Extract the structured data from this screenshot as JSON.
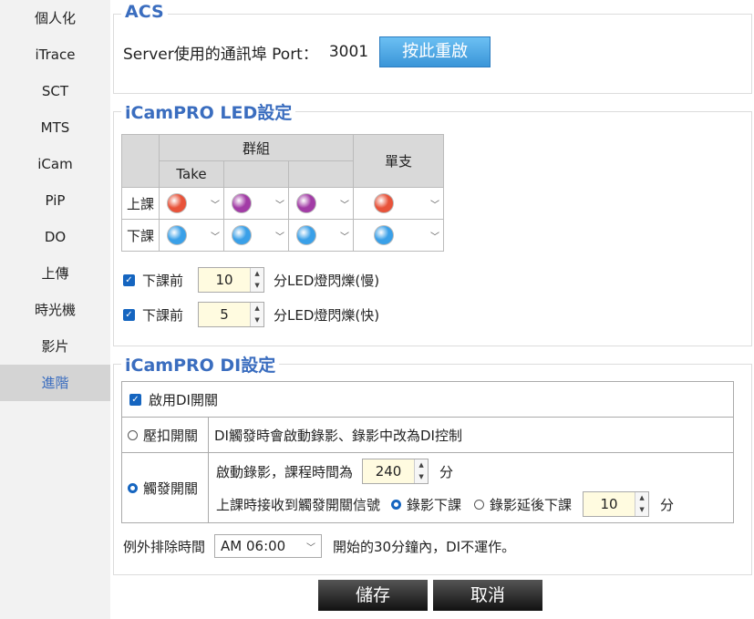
{
  "sidebar": {
    "items": [
      {
        "label": "個人化"
      },
      {
        "label": "iTrace"
      },
      {
        "label": "SCT"
      },
      {
        "label": "MTS"
      },
      {
        "label": "iCam"
      },
      {
        "label": "PiP"
      },
      {
        "label": "DO"
      },
      {
        "label": "上傳"
      },
      {
        "label": "時光機"
      },
      {
        "label": "影片"
      },
      {
        "label": "進階"
      }
    ],
    "active_index": 10
  },
  "acs": {
    "title": "ACS",
    "port_label": "Server使用的通訊埠 Port：",
    "port_value": "3001",
    "restart_button": "按此重啟"
  },
  "led": {
    "title": "iCamPRO LED設定",
    "group_header": "群組",
    "take_header": "Take",
    "single_header": "單支",
    "rows": [
      {
        "label": "上課",
        "colors": [
          "#e8533a",
          "#a23ca6",
          "#a23ca6",
          "#e8533a"
        ]
      },
      {
        "label": "下課",
        "colors": [
          "#3aa0e8",
          "#3aa0e8",
          "#3aa0e8",
          "#3aa0e8"
        ]
      }
    ],
    "blink_slow": {
      "label": "下課前",
      "value": "10",
      "suffix": "分LED燈閃爍(慢)"
    },
    "blink_fast": {
      "label": "下課前",
      "value": "5",
      "suffix": "分LED燈閃爍(快)"
    }
  },
  "di": {
    "title": "iCamPRO DI設定",
    "enable_label": "啟用DI開關",
    "press_label": "壓扣開關",
    "press_desc": "DI觸發時會啟動錄影、錄影中改為DI控制",
    "trigger_label": "觸發開關",
    "trigger_line1_label": "啟動錄影，課程時間為",
    "trigger_line1_value": "240",
    "trigger_line1_unit": "分",
    "trigger_line2_label": "上課時接收到觸發開關信號",
    "opt_end": "錄影下課",
    "opt_delay": "錄影延後下課",
    "delay_value": "10",
    "delay_unit": "分",
    "except_label": "例外排除時間",
    "except_value": "AM 06:00",
    "except_suffix": "開始的30分鐘內，DI不運作。"
  },
  "buttons": {
    "save": "儲存",
    "cancel": "取消"
  }
}
